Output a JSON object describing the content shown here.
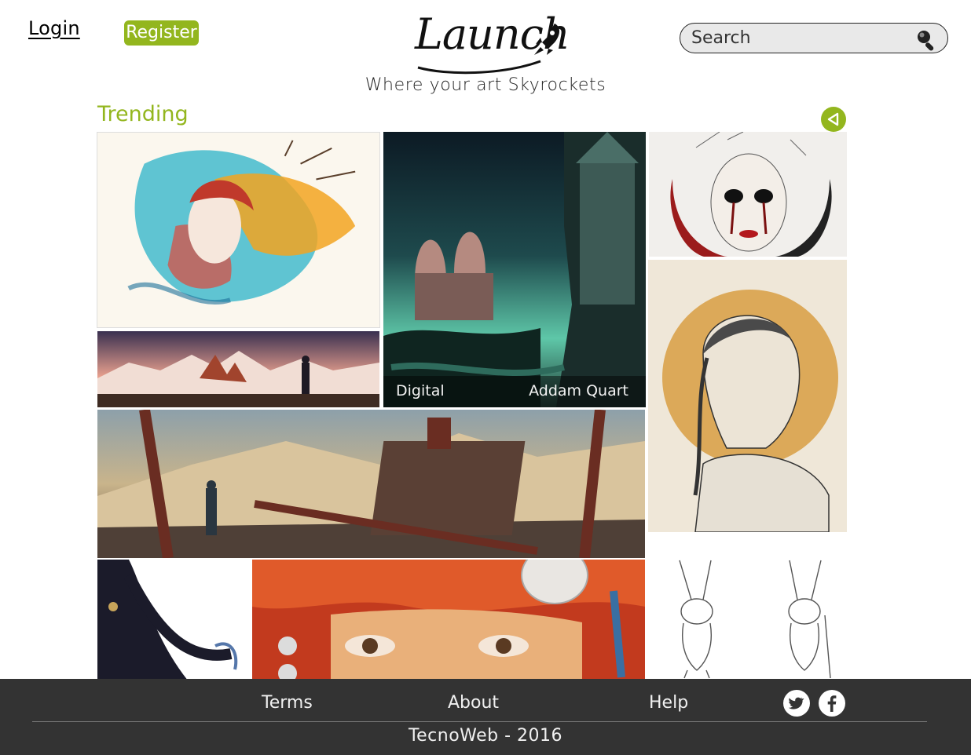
{
  "header": {
    "login_label": "Login",
    "register_label": "Register",
    "logo_text": "Launch",
    "tagline": "Where your art Skyrockets",
    "search_placeholder": "Search"
  },
  "trending": {
    "title": "Trending",
    "hover_overlay": {
      "category": "Digital",
      "author": "Addam Quart"
    },
    "artworks": [
      {
        "name": "watercolor-portrait",
        "palette": [
          "#2bb3c8",
          "#f2a521",
          "#e0483b"
        ]
      },
      {
        "name": "mountain-sunset-photo",
        "palette": [
          "#e8a08e",
          "#3a2d3a",
          "#f2d6c8"
        ]
      },
      {
        "name": "fantasy-castle",
        "palette": [
          "#1e4a4d",
          "#5ec7a8",
          "#0c1a24"
        ]
      },
      {
        "name": "mask-sketch",
        "palette": [
          "#f1efec",
          "#9b1c1c",
          "#222222"
        ]
      },
      {
        "name": "girl-profile-sketch",
        "palette": [
          "#efe7d8",
          "#d79a3a",
          "#333333"
        ]
      },
      {
        "name": "wasteland-landscape",
        "palette": [
          "#c9b48b",
          "#6a2d22",
          "#2a3640"
        ]
      },
      {
        "name": "dark-witch",
        "palette": [
          "#ffffff",
          "#1b1b2a",
          "#5577aa"
        ]
      },
      {
        "name": "painted-face-closeup",
        "palette": [
          "#c23a1e",
          "#e98a2e",
          "#3a6fa2"
        ]
      },
      {
        "name": "rabbit-character-sketch",
        "palette": [
          "#ffffff",
          "#555555",
          "#bbbbbb"
        ]
      }
    ]
  },
  "footer": {
    "terms_label": "Terms",
    "about_label": "About",
    "help_label": "Help",
    "copyright": "TecnoWeb - 2016"
  },
  "colors": {
    "accent": "#93b61e",
    "footer_bg": "#333333",
    "text": "#111111"
  },
  "icons": {
    "search": "search-icon",
    "back": "triangle-left-icon",
    "twitter": "twitter-icon",
    "facebook": "facebook-icon",
    "logo_rocket": "rocket-icon"
  }
}
